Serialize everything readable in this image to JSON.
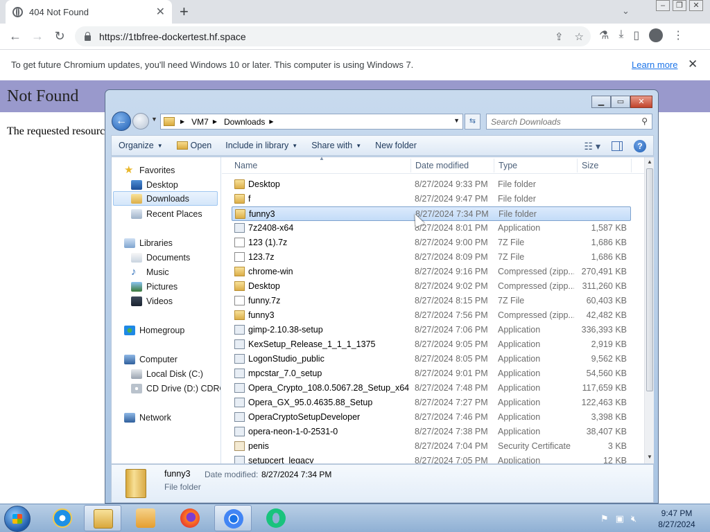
{
  "browser": {
    "tab_title": "404 Not Found",
    "tab_close": "✕",
    "new_tab": "+",
    "url": "https://1tbfree-dockertest.hf.space",
    "infobar_message": "To get future Chromium updates, you'll need Windows 10 or later. This computer is using Windows 7.",
    "infobar_link": "Learn more",
    "infobar_close": "✕"
  },
  "page": {
    "heading": "Not Found",
    "text": "The requested resource was not found on this server."
  },
  "explorer": {
    "breadcrumb": [
      "VM7",
      "Downloads"
    ],
    "search_placeholder": "Search Downloads",
    "commands": {
      "organize": "Organize",
      "open": "Open",
      "include": "Include in library",
      "share": "Share with",
      "new_folder": "New folder"
    },
    "columns": {
      "name": "Name",
      "date": "Date modified",
      "type": "Type",
      "size": "Size"
    },
    "nav": {
      "favorites": "Favorites",
      "desktop": "Desktop",
      "downloads": "Downloads",
      "recent": "Recent Places",
      "libraries": "Libraries",
      "documents": "Documents",
      "music": "Music",
      "pictures": "Pictures",
      "videos": "Videos",
      "homegroup": "Homegroup",
      "computer": "Computer",
      "local_disk": "Local Disk (C:)",
      "cd_drive": "CD Drive (D:) CDROM",
      "network": "Network"
    },
    "files": [
      {
        "name": "Desktop",
        "date": "8/27/2024 9:33 PM",
        "type": "File folder",
        "size": "",
        "icon": "folder"
      },
      {
        "name": "f",
        "date": "8/27/2024 9:47 PM",
        "type": "File folder",
        "size": "",
        "icon": "folder"
      },
      {
        "name": "funny3",
        "date": "8/27/2024 7:34 PM",
        "type": "File folder",
        "size": "",
        "icon": "folder"
      },
      {
        "name": "7z2408-x64",
        "date": "8/27/2024 8:01 PM",
        "type": "Application",
        "size": "1,587 KB",
        "icon": "app"
      },
      {
        "name": "123 (1).7z",
        "date": "8/27/2024 9:00 PM",
        "type": "7Z File",
        "size": "1,686 KB",
        "icon": "file"
      },
      {
        "name": "123.7z",
        "date": "8/27/2024 8:09 PM",
        "type": "7Z File",
        "size": "1,686 KB",
        "icon": "file"
      },
      {
        "name": "chrome-win",
        "date": "8/27/2024 9:16 PM",
        "type": "Compressed (zipp...",
        "size": "270,491 KB",
        "icon": "zip"
      },
      {
        "name": "Desktop",
        "date": "8/27/2024 9:02 PM",
        "type": "Compressed (zipp...",
        "size": "311,260 KB",
        "icon": "zip"
      },
      {
        "name": "funny.7z",
        "date": "8/27/2024 8:15 PM",
        "type": "7Z File",
        "size": "60,403 KB",
        "icon": "file"
      },
      {
        "name": "funny3",
        "date": "8/27/2024 7:56 PM",
        "type": "Compressed (zipp...",
        "size": "42,482 KB",
        "icon": "zip"
      },
      {
        "name": "gimp-2.10.38-setup",
        "date": "8/27/2024 7:06 PM",
        "type": "Application",
        "size": "336,393 KB",
        "icon": "app"
      },
      {
        "name": "KexSetup_Release_1_1_1_1375",
        "date": "8/27/2024 9:05 PM",
        "type": "Application",
        "size": "2,919 KB",
        "icon": "app"
      },
      {
        "name": "LogonStudio_public",
        "date": "8/27/2024 8:05 PM",
        "type": "Application",
        "size": "9,562 KB",
        "icon": "app"
      },
      {
        "name": "mpcstar_7.0_setup",
        "date": "8/27/2024 9:01 PM",
        "type": "Application",
        "size": "54,560 KB",
        "icon": "app"
      },
      {
        "name": "Opera_Crypto_108.0.5067.28_Setup_x64",
        "date": "8/27/2024 7:48 PM",
        "type": "Application",
        "size": "117,659 KB",
        "icon": "app"
      },
      {
        "name": "Opera_GX_95.0.4635.88_Setup",
        "date": "8/27/2024 7:27 PM",
        "type": "Application",
        "size": "122,463 KB",
        "icon": "app"
      },
      {
        "name": "OperaCryptoSetupDeveloper",
        "date": "8/27/2024 7:46 PM",
        "type": "Application",
        "size": "3,398 KB",
        "icon": "app"
      },
      {
        "name": "opera-neon-1-0-2531-0",
        "date": "8/27/2024 7:38 PM",
        "type": "Application",
        "size": "38,407 KB",
        "icon": "app"
      },
      {
        "name": "penis",
        "date": "8/27/2024 7:04 PM",
        "type": "Security Certificate",
        "size": "3 KB",
        "icon": "cert"
      },
      {
        "name": "setupcert_legacy",
        "date": "8/27/2024 7:05 PM",
        "type": "Application",
        "size": "12 KB",
        "icon": "app"
      }
    ],
    "selected_index": 2,
    "details": {
      "name": "funny3",
      "date_label": "Date modified:",
      "date_value": "8/27/2024 7:34 PM",
      "type": "File folder"
    }
  },
  "taskbar": {
    "time": "9:47 PM",
    "date": "8/27/2024"
  }
}
